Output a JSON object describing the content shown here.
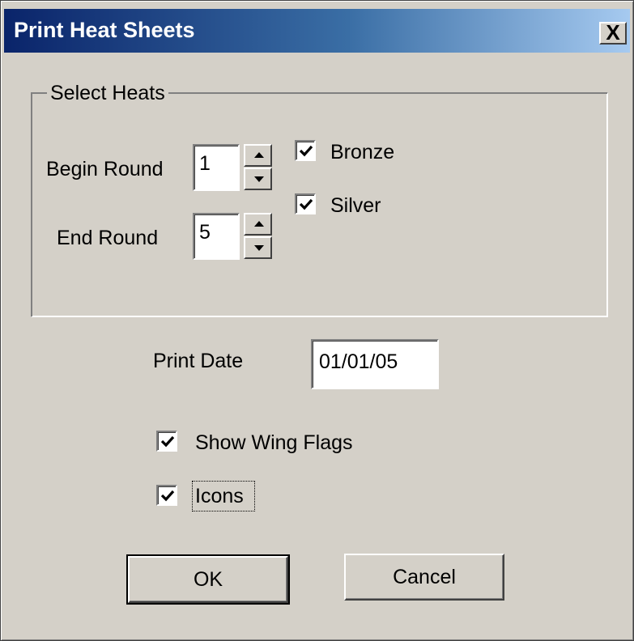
{
  "window": {
    "title": "Print Heat Sheets",
    "close_glyph": "X"
  },
  "select_heats": {
    "group_label": "Select Heats",
    "begin_round_label": "Begin Round",
    "begin_round_value": "1",
    "end_round_label": "End Round",
    "end_round_value": "5",
    "bronze_label": "Bronze",
    "bronze_checked": true,
    "silver_label": "Silver",
    "silver_checked": true
  },
  "print_date": {
    "label": "Print Date",
    "value": "01/01/05"
  },
  "options": {
    "show_wing_flags_label": "Show Wing Flags",
    "show_wing_flags_checked": true,
    "icons_label": "Icons",
    "icons_checked": true
  },
  "buttons": {
    "ok_label": "OK",
    "cancel_label": "Cancel"
  },
  "icons": {
    "close": "close-icon",
    "spin_up": "arrow-up-icon",
    "spin_down": "arrow-down-icon",
    "checkmark": "checkmark-icon"
  }
}
